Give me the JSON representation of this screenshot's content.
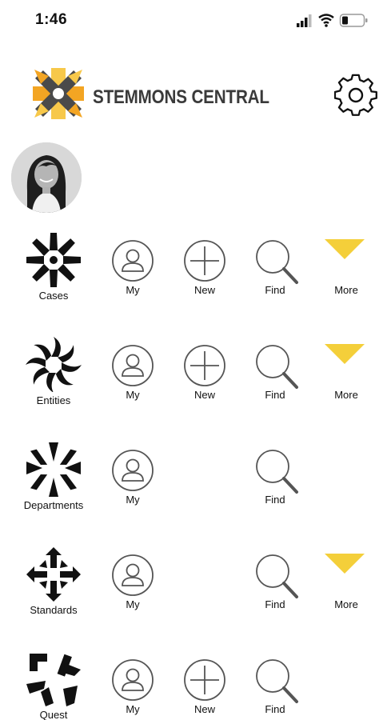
{
  "status_bar": {
    "time": "1:46"
  },
  "header": {
    "app_name": "STEMMONS CENTRAL",
    "accent_colors": [
      "#f3a523",
      "#f7c84a",
      "#4a4a4a"
    ]
  },
  "actions": {
    "my_label": "My",
    "new_label": "New",
    "find_label": "Find",
    "more_label": "More",
    "more_color": "#f4cf3a"
  },
  "modules": [
    {
      "name": "Cases",
      "icon": "cases-burst-icon",
      "my": true,
      "new": true,
      "find": true,
      "more": true
    },
    {
      "name": "Entities",
      "icon": "entities-swirl-icon",
      "my": true,
      "new": true,
      "find": true,
      "more": true
    },
    {
      "name": "Departments",
      "icon": "departments-chevrons-icon",
      "my": true,
      "new": false,
      "find": true,
      "more": false
    },
    {
      "name": "Standards",
      "icon": "standards-arrows-icon",
      "my": true,
      "new": false,
      "find": true,
      "more": true
    },
    {
      "name": "Quest",
      "icon": "quest-arrows-icon",
      "my": true,
      "new": true,
      "find": true,
      "more": false
    }
  ]
}
